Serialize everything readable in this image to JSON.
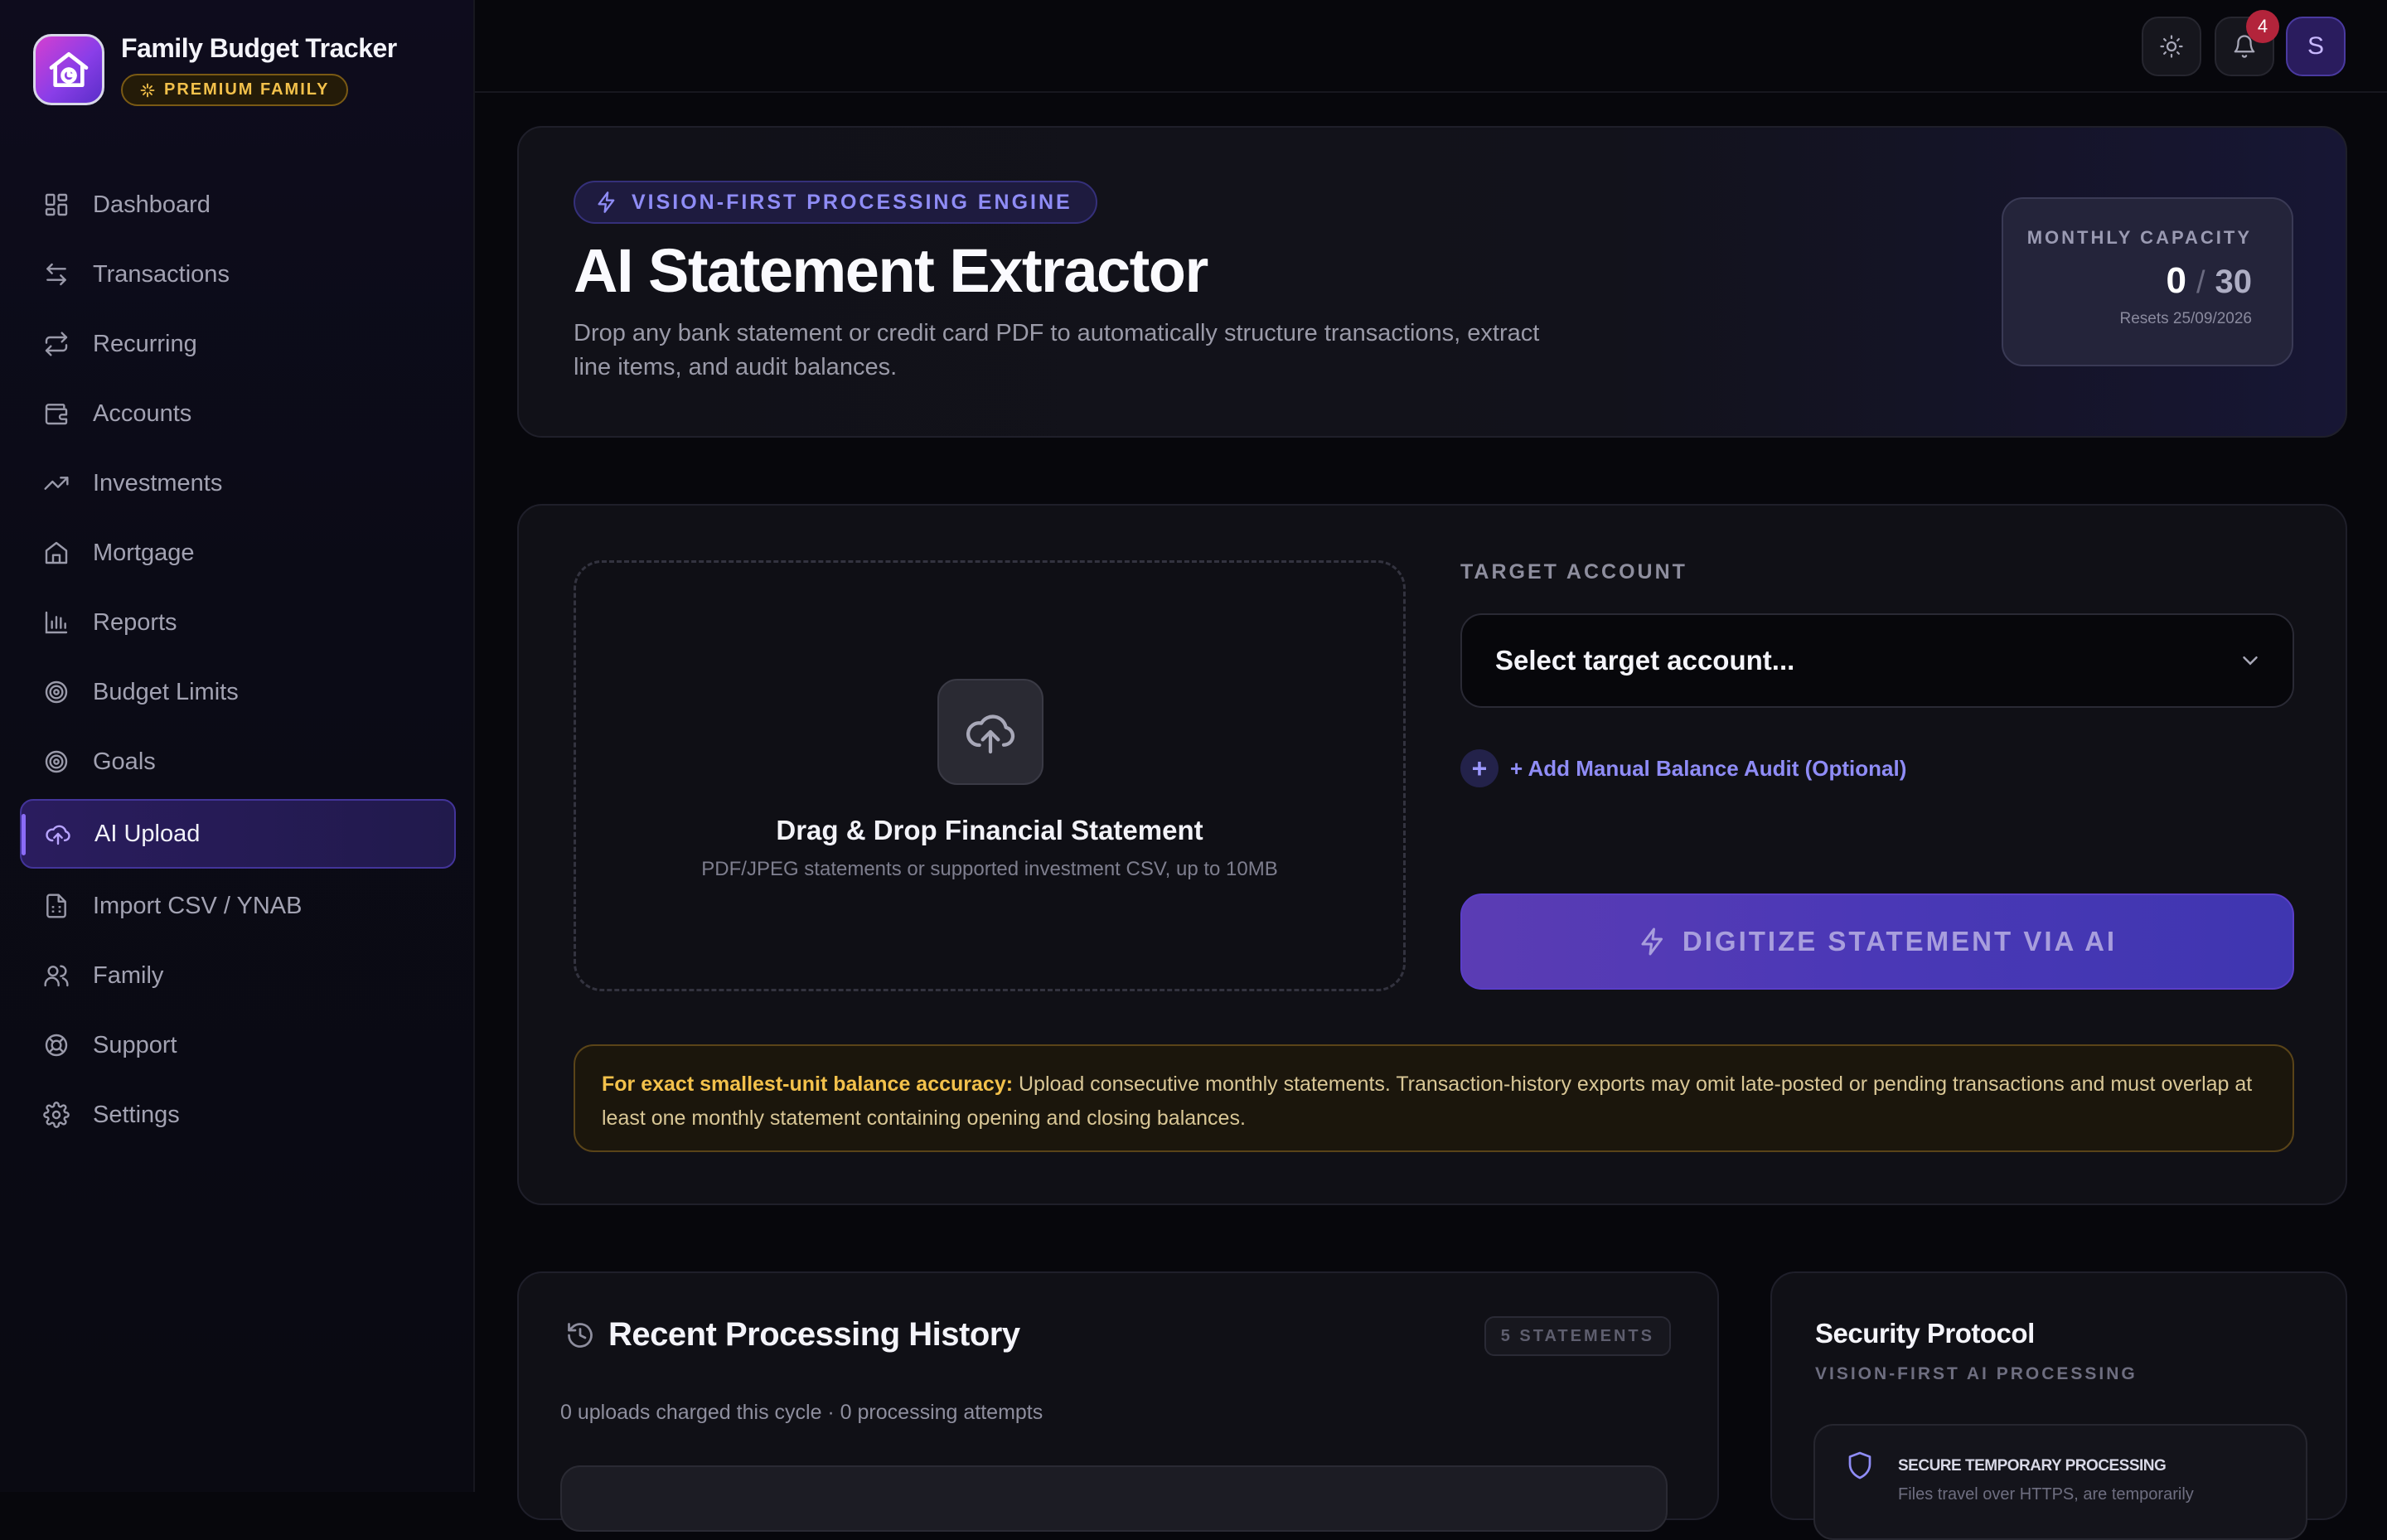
{
  "app": {
    "title": "Family Budget Tracker",
    "plan_badge": "PREMIUM FAMILY"
  },
  "sidebar": {
    "items": [
      {
        "label": "Dashboard",
        "icon": "grid-icon"
      },
      {
        "label": "Transactions",
        "icon": "arrows-swap-icon"
      },
      {
        "label": "Recurring",
        "icon": "repeat-icon"
      },
      {
        "label": "Accounts",
        "icon": "wallet-icon"
      },
      {
        "label": "Investments",
        "icon": "trending-up-icon"
      },
      {
        "label": "Mortgage",
        "icon": "home-icon"
      },
      {
        "label": "Reports",
        "icon": "bar-chart-icon"
      },
      {
        "label": "Budget Limits",
        "icon": "target-icon"
      },
      {
        "label": "Goals",
        "icon": "target-icon"
      },
      {
        "label": "AI Upload",
        "icon": "cloud-upload-icon",
        "active": true
      },
      {
        "label": "Import CSV / YNAB",
        "icon": "file-spreadsheet-icon"
      },
      {
        "label": "Family",
        "icon": "users-icon"
      },
      {
        "label": "Support",
        "icon": "lifebuoy-icon"
      },
      {
        "label": "Settings",
        "icon": "gear-icon"
      }
    ]
  },
  "topbar": {
    "notification_count": "4",
    "avatar_initial": "S"
  },
  "hero": {
    "pill": "VISION-FIRST PROCESSING ENGINE",
    "title": "AI Statement Extractor",
    "description": "Drop any bank statement or credit card PDF to automatically structure transactions, extract line items, and audit balances.",
    "capacity": {
      "label": "MONTHLY CAPACITY",
      "used": "0",
      "separator": "/",
      "limit": "30",
      "reset": "Resets 25/09/2026"
    }
  },
  "upload": {
    "dropzone_title": "Drag & Drop Financial Statement",
    "dropzone_subtitle": "PDF/JPEG statements or supported investment CSV, up to 10MB",
    "target_label": "TARGET ACCOUNT",
    "target_placeholder": "Select target account...",
    "audit_link": "+ Add Manual Balance Audit (Optional)",
    "digitize_label": "DIGITIZE STATEMENT VIA AI",
    "warning_bold": "For exact smallest-unit balance accuracy:",
    "warning_text": " Upload consecutive monthly statements. Transaction-history exports may omit late-posted or pending transactions and must overlap at least one monthly statement containing opening and closing balances."
  },
  "history": {
    "title": "Recent Processing History",
    "badge": "5 STATEMENTS",
    "subtitle": "0 uploads charged this cycle · 0 processing attempts"
  },
  "security": {
    "title": "Security Protocol",
    "subtitle": "VISION-FIRST AI PROCESSING",
    "item_title": "SECURE TEMPORARY PROCESSING",
    "item_text": "Files travel over HTTPS, are temporarily"
  },
  "colors": {
    "accent": "#8b6cf6",
    "warning": "#f3c14b",
    "background": "#07070c"
  }
}
